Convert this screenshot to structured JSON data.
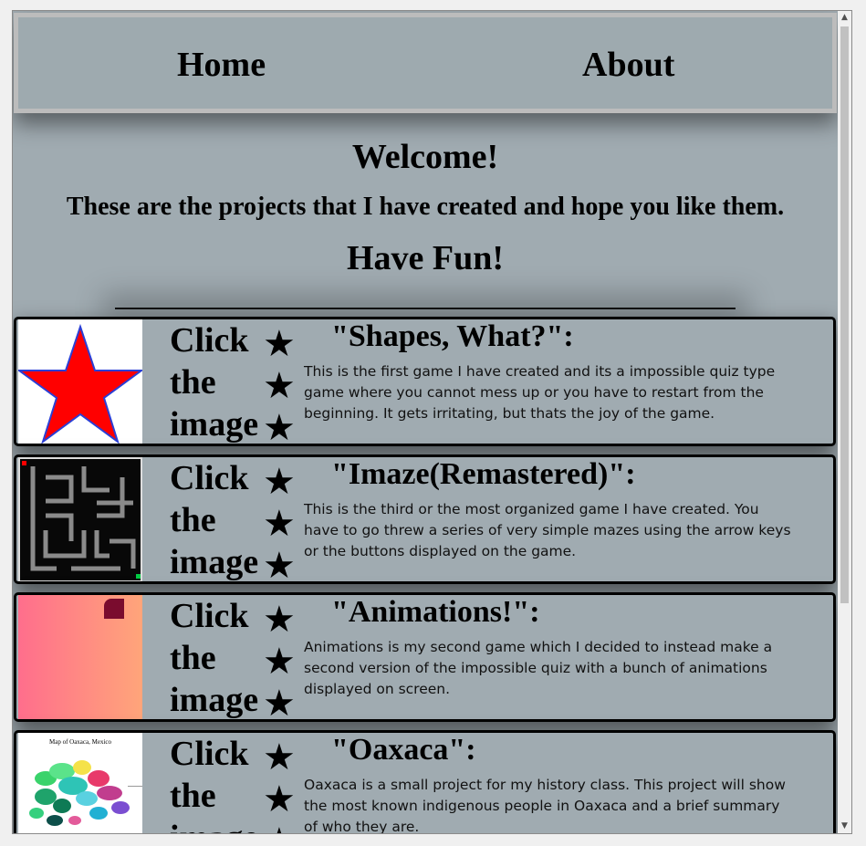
{
  "nav": {
    "home": "Home",
    "about": "About"
  },
  "welcome": {
    "title": "Welcome!",
    "subtitle": "These are the projects that I have created and hope you like them.",
    "fun": "Have Fun!"
  },
  "projects": [
    {
      "click_text": "Click the image",
      "stars": "★★★",
      "title": "\"Shapes, What?\":",
      "description": "This is the first game I have created and its a impossible quiz type game where you cannot mess up or you have to restart from the beginning. It gets irritating, but thats the joy of the game.",
      "thumbnail": "red-star-image"
    },
    {
      "click_text": "Click the image",
      "stars": "★★★",
      "title": "\"Imaze(Remastered)\":",
      "description": "This is the third or the most organized game I have created. You have to go threw a series of very simple mazes using the arrow keys or the buttons displayed on the game.",
      "thumbnail": "maze-image"
    },
    {
      "click_text": "Click the image",
      "stars": "★★★",
      "title": "\"Animations!\":",
      "description": "Animations is my second game which I decided to instead make a second version of the impossible quiz with a bunch of animations displayed on screen.",
      "thumbnail": "gradient-image"
    },
    {
      "click_text": "Click the image",
      "stars": "★★★",
      "title": "\"Oaxaca\":",
      "description": "Oaxaca is a small project for my history class. This project will show the most known indigenous people in Oaxaca and a brief summary of who they are.",
      "thumbnail": "oaxaca-map-image",
      "map_caption": "Map of Oaxaca, Mexico"
    }
  ],
  "colors": {
    "page_bg": "#a0abb1",
    "nav_border": "#bcbcbc",
    "star_fill": "#ff0000",
    "star_stroke": "#2a3fd6"
  }
}
